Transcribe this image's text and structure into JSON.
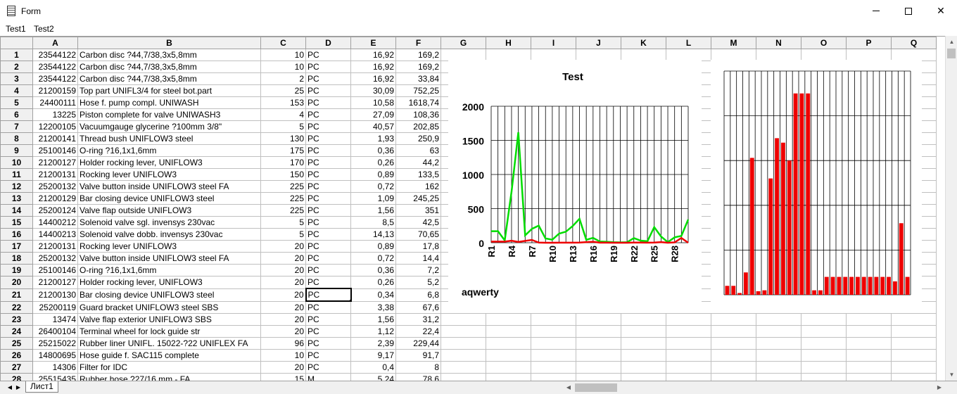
{
  "window": {
    "title": "Form"
  },
  "menu": [
    "Test1",
    "Test2"
  ],
  "columns": [
    "A",
    "B",
    "C",
    "D",
    "E",
    "F",
    "G",
    "H",
    "I",
    "J",
    "K",
    "L",
    "M",
    "N",
    "O",
    "P",
    "Q"
  ],
  "rows": [
    [
      "1",
      "23544122",
      "Carbon disc ?44,7/38,3x5,8mm",
      "10",
      "PC",
      "16,92",
      "169,2"
    ],
    [
      "2",
      "23544122",
      "Carbon disc ?44,7/38,3x5,8mm",
      "10",
      "PC",
      "16,92",
      "169,2"
    ],
    [
      "3",
      "23544122",
      "Carbon disc ?44,7/38,3x5,8mm",
      "2",
      "PC",
      "16,92",
      "33,84"
    ],
    [
      "4",
      "21200159",
      "Top part UNIFL3/4 for steel bot.part",
      "25",
      "PC",
      "30,09",
      "752,25"
    ],
    [
      "5",
      "24400111",
      "Hose f. pump compl. UNIWASH",
      "153",
      "PC",
      "10,58",
      "1618,74"
    ],
    [
      "6",
      "13225",
      "Piston complete for valve UNIWASH3",
      "4",
      "PC",
      "27,09",
      "108,36"
    ],
    [
      "7",
      "12200105",
      "Vacuumgauge glycerine ?100mm 3/8\"",
      "5",
      "PC",
      "40,57",
      "202,85"
    ],
    [
      "8",
      "21200141",
      "Thread bush UNIFLOW3 steel",
      "130",
      "PC",
      "1,93",
      "250,9"
    ],
    [
      "9",
      "25100146",
      "O-ring ?16,1x1,6mm",
      "175",
      "PC",
      "0,36",
      "63"
    ],
    [
      "10",
      "21200127",
      "Holder rocking lever, UNIFLOW3",
      "170",
      "PC",
      "0,26",
      "44,2"
    ],
    [
      "11",
      "21200131",
      "Rocking lever UNIFLOW3",
      "150",
      "PC",
      "0,89",
      "133,5"
    ],
    [
      "12",
      "25200132",
      "Valve button inside UNIFLOW3 steel FA",
      "225",
      "PC",
      "0,72",
      "162"
    ],
    [
      "13",
      "21200129",
      "Bar closing device UNIFLOW3 steel",
      "225",
      "PC",
      "1,09",
      "245,25"
    ],
    [
      "14",
      "25200124",
      "Valve flap outside UNIFLOW3",
      "225",
      "PC",
      "1,56",
      "351"
    ],
    [
      "15",
      "14400212",
      "Solenoid valve sgl. invensys 230vac",
      "5",
      "PC",
      "8,5",
      "42,5"
    ],
    [
      "16",
      "14400213",
      "Solenoid valve dobb. invensys 230vac",
      "5",
      "PC",
      "14,13",
      "70,65"
    ],
    [
      "17",
      "21200131",
      "Rocking lever UNIFLOW3",
      "20",
      "PC",
      "0,89",
      "17,8"
    ],
    [
      "18",
      "25200132",
      "Valve button inside UNIFLOW3 steel FA",
      "20",
      "PC",
      "0,72",
      "14,4"
    ],
    [
      "19",
      "25100146",
      "O-ring ?16,1x1,6mm",
      "20",
      "PC",
      "0,36",
      "7,2"
    ],
    [
      "20",
      "21200127",
      "Holder rocking lever, UNIFLOW3",
      "20",
      "PC",
      "0,26",
      "5,2"
    ],
    [
      "21",
      "21200130",
      "Bar closing device UNIFLOW3 steel",
      "20",
      "PC",
      "0,34",
      "6,8"
    ],
    [
      "22",
      "25200119",
      "Guard bracket UNIFLOW3 steel SBS",
      "20",
      "PC",
      "3,38",
      "67,6"
    ],
    [
      "23",
      "13474",
      "Valve flap exterior UNIFLOW3 SBS",
      "20",
      "PC",
      "1,56",
      "31,2"
    ],
    [
      "24",
      "26400104",
      "Terminal wheel for lock guide str",
      "20",
      "PC",
      "1,12",
      "22,4"
    ],
    [
      "25",
      "25215022",
      "Rubber liner UNIFL. 15022-?22 UNIFLEX FA",
      "96",
      "PC",
      "2,39",
      "229,44"
    ],
    [
      "26",
      "14800695",
      "Hose guide f. SAC115 complete",
      "10",
      "PC",
      "9,17",
      "91,7"
    ],
    [
      "27",
      "14306",
      "Filter for IDC",
      "20",
      "PC",
      "0,4",
      "8"
    ],
    [
      "28",
      "25515435",
      "Rubber hose ?27/16 mm - FA",
      "15",
      "M",
      "5,24",
      "78,6"
    ]
  ],
  "selected_cell": "D21",
  "sheet_tab": "Лист1",
  "chart_data": [
    {
      "type": "line",
      "title": "Test",
      "footer": "aqwerty",
      "x": [
        "R1",
        "R2",
        "R3",
        "R4",
        "R5",
        "R6",
        "R7",
        "R8",
        "R9",
        "R10",
        "R11",
        "R12",
        "R13",
        "R14",
        "R15",
        "R16",
        "R17",
        "R18",
        "R19",
        "R20",
        "R21",
        "R22",
        "R23",
        "R24",
        "R25",
        "R26",
        "R27",
        "R28",
        "R29",
        "R30"
      ],
      "x_ticks": [
        "R1",
        "R4",
        "R7",
        "R10",
        "R13",
        "R16",
        "R19",
        "R22",
        "R25",
        "R28"
      ],
      "ylim": [
        0,
        2000
      ],
      "y_ticks": [
        "0",
        "500",
        "1000",
        "1500",
        "2000"
      ],
      "grid": true,
      "series": [
        {
          "color": "#00dd00",
          "values": [
            169,
            169,
            34,
            752,
            1619,
            108,
            203,
            251,
            63,
            44,
            134,
            162,
            245,
            351,
            43,
            71,
            18,
            14,
            7,
            5,
            7,
            68,
            31,
            22,
            229,
            92,
            8,
            79,
            100,
            340
          ]
        },
        {
          "color": "#ee0000",
          "values": [
            17,
            17,
            17,
            30,
            11,
            27,
            41,
            2,
            0,
            0,
            1,
            1,
            1,
            2,
            9,
            14,
            1,
            1,
            0,
            0,
            0,
            3,
            2,
            1,
            2,
            9,
            0,
            5,
            70,
            0
          ]
        }
      ]
    },
    {
      "type": "bar",
      "color": "#ee0000",
      "grid": true,
      "values": [
        10,
        10,
        2,
        25,
        153,
        4,
        5,
        130,
        175,
        170,
        150,
        225,
        225,
        225,
        5,
        5,
        20,
        20,
        20,
        20,
        20,
        20,
        20,
        20,
        20,
        20,
        20,
        15,
        80,
        20
      ]
    }
  ],
  "colors": {
    "line1": "#00dd00",
    "line2": "#ee0000",
    "bar": "#ee0000",
    "header_bg": "#f0f0f0",
    "grid": "#c0c0c0"
  }
}
